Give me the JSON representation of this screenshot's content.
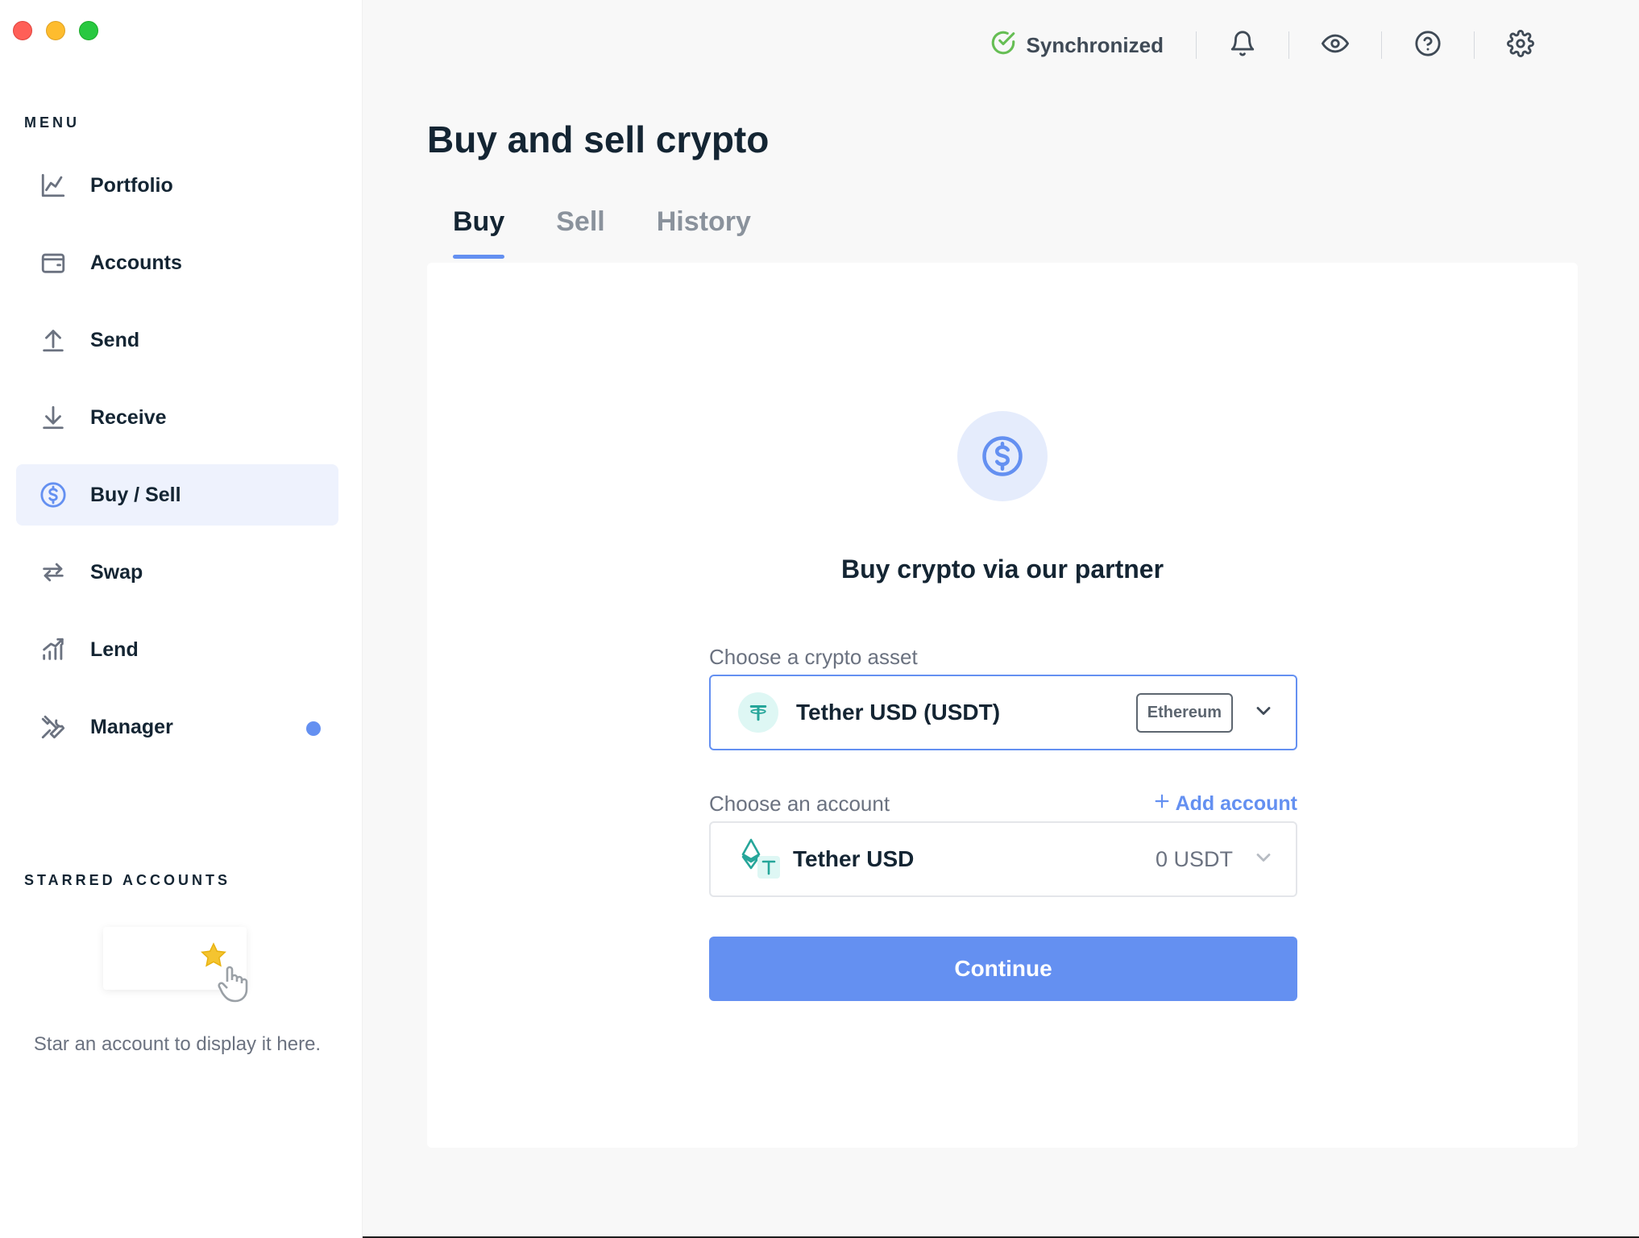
{
  "window": {
    "controls": [
      "close",
      "minimize",
      "maximize"
    ]
  },
  "sidebar": {
    "menu_label": "MENU",
    "items": [
      {
        "label": "Portfolio",
        "icon": "chart-line-icon"
      },
      {
        "label": "Accounts",
        "icon": "wallet-icon"
      },
      {
        "label": "Send",
        "icon": "arrow-up-icon"
      },
      {
        "label": "Receive",
        "icon": "arrow-down-icon"
      },
      {
        "label": "Buy / Sell",
        "icon": "dollar-circle-icon",
        "active": true
      },
      {
        "label": "Swap",
        "icon": "swap-arrows-icon"
      },
      {
        "label": "Lend",
        "icon": "lend-bars-icon"
      },
      {
        "label": "Manager",
        "icon": "tools-icon",
        "notification_dot": true
      }
    ],
    "starred": {
      "label": "STARRED ACCOUNTS",
      "empty_text": "Star an account to display it here."
    }
  },
  "topbar": {
    "sync_status": "Synchronized",
    "icons": [
      "bell-icon",
      "eye-icon",
      "help-icon",
      "settings-icon"
    ]
  },
  "main": {
    "title": "Buy and sell crypto",
    "tabs": [
      {
        "label": "Buy",
        "active": true
      },
      {
        "label": "Sell"
      },
      {
        "label": "History"
      }
    ],
    "card": {
      "heading": "Buy crypto via our partner",
      "asset_field": {
        "label": "Choose a crypto asset",
        "value": "Tether USD (USDT)",
        "network_badge": "Ethereum"
      },
      "account_field": {
        "label": "Choose an account",
        "add_label": "Add account",
        "value": "Tether USD",
        "balance": "0 USDT"
      },
      "continue_label": "Continue"
    }
  },
  "colors": {
    "accent": "#6490f1",
    "sync_ok": "#66be54",
    "tether": "#26a69a"
  }
}
